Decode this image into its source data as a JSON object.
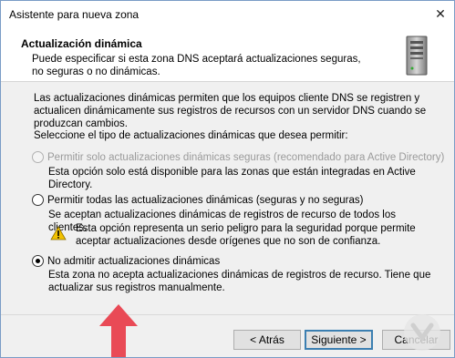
{
  "window": {
    "title": "Asistente para nueva zona",
    "close_glyph": "✕"
  },
  "header": {
    "title": "Actualización dinámica",
    "subtitle": "Puede especificar si esta zona DNS aceptará actualizaciones seguras, no seguras o no dinámicas.",
    "icon": "server-icon"
  },
  "body": {
    "intro": "Las actualizaciones dinámicas permiten que los equipos cliente DNS se registren y actualicen dinámicamente sus registros de recursos con un servidor DNS cuando se produzcan cambios.",
    "prompt": "Seleccione el tipo de actualizaciones dinámicas que desea permitir:",
    "options": [
      {
        "label": "Permitir solo actualizaciones dinámicas seguras (recomendado para Active Directory)",
        "description": "Esta opción solo está disponible para las zonas que están integradas en Active Directory.",
        "enabled": false,
        "selected": false
      },
      {
        "label": "Permitir todas las actualizaciones dinámicas (seguras y no seguras)",
        "description": "Se aceptan actualizaciones dinámicas de registros de recurso de todos los clientes.",
        "warning": "Esta opción representa un serio peligro para la seguridad porque permite aceptar actualizaciones desde orígenes que no son de confianza.",
        "enabled": true,
        "selected": false
      },
      {
        "label": "No admitir actualizaciones dinámicas",
        "description": "Esta zona no acepta actualizaciones dinámicas de registros de recurso. Tiene que actualizar sus registros manualmente.",
        "enabled": true,
        "selected": true
      }
    ]
  },
  "buttons": {
    "back": "< Atrás",
    "next": "Siguiente >",
    "cancel": "Cancelar"
  },
  "colors": {
    "accent": "#3c7fb1",
    "arrow": "#e94a56",
    "warning": "#f2c200"
  }
}
